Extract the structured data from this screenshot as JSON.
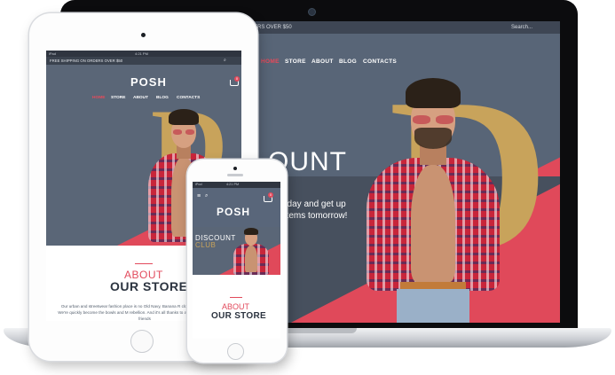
{
  "brand": {
    "name": "POSH",
    "accent": "#e24a5c",
    "gold": "#c8a35b",
    "slate": "#586577"
  },
  "laptop": {
    "topbar_left": "ERS OVER $50",
    "search_label": "Search...",
    "nav": [
      {
        "label": "HOME",
        "active": true
      },
      {
        "label": "STORE",
        "active": false
      },
      {
        "label": "ABOUT",
        "active": false
      },
      {
        "label": "BLOG",
        "active": false
      },
      {
        "label": "CONTACTS",
        "active": false
      }
    ],
    "hero_letter": "D",
    "hero_headline": "OUNT",
    "hero_sub_1": "oday and get up",
    "hero_sub_2": "g items tomorrow!"
  },
  "tablet": {
    "status_time": "4:21 PM",
    "status_left": "iPad",
    "topbar_text": "FREE SHIPPING ON ORDERS OVER $50",
    "logo": "POSH",
    "cart_count": "0",
    "nav": [
      {
        "label": "HOME",
        "active": true
      },
      {
        "label": "STORE",
        "active": false
      },
      {
        "label": "ABOUT",
        "active": false
      },
      {
        "label": "BLOG",
        "active": false
      },
      {
        "label": "CONTACTS",
        "active": false
      }
    ],
    "about_label": "ABOUT",
    "our_store_label": "OUR STORE",
    "paragraph": "Our urban and streetwear fashion place is no Old Navy, Banana R clothing store. God forbid. We're quickly become the bowls and M rebellion. And it's all thanks to a trio of it's Jessie and her friends"
  },
  "phone": {
    "status_time": "4:21 PM",
    "status_left": "iPod",
    "logo": "POSH",
    "cart_count": "0",
    "discount_label": "DISCOUNT",
    "club_label": "CLUB",
    "about_label": "ABOUT",
    "our_store_label": "OUR STORE"
  }
}
